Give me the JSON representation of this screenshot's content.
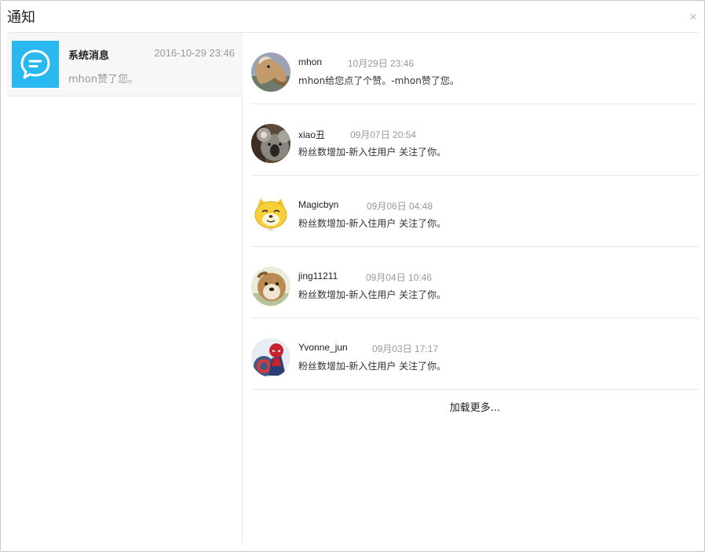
{
  "dialog": {
    "title": "通知",
    "close_glyph": "×"
  },
  "conversation": {
    "icon": "chat-bubble-icon",
    "icon_color": "#2ab8f0",
    "name": "系统消息",
    "time": "2016-10-29 23:46",
    "preview": "mhon赞了您。"
  },
  "messages": [
    {
      "user": "mhon",
      "time": "10月29日 23:46",
      "text": "mhon给您点了个赞。-mhon赞了您。",
      "avatar": "horse-avatar"
    },
    {
      "user": "xiao丑",
      "time": "09月07日 20:54",
      "text": "粉丝数增加-新入住用户 关注了你。",
      "avatar": "koala-avatar"
    },
    {
      "user": "Magicbyn",
      "time": "09月06日 04:48",
      "text": "粉丝数增加-新入住用户 关注了你。",
      "avatar": "doge-avatar"
    },
    {
      "user": "jing11211",
      "time": "09月04日 10:46",
      "text": "粉丝数增加-新入住用户 关注了你。",
      "avatar": "dog-avatar"
    },
    {
      "user": "Yvonne_jun",
      "time": "09月03日 17:17",
      "text": "粉丝数增加-新入住用户 关注了你。",
      "avatar": "spiderman-avatar"
    }
  ],
  "load_more": "加载更多..."
}
